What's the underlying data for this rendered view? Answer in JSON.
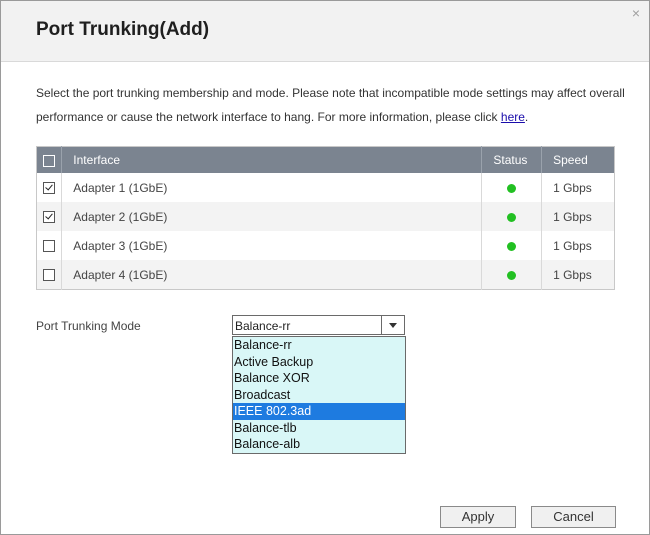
{
  "dialog": {
    "title": "Port Trunking(Add)",
    "close_glyph": "×",
    "description_text": "Select the port trunking membership and mode. Please note that incompatible mode settings may affect overall performance or cause the network interface to hang. For more information, please click ",
    "description_link": "here",
    "description_end": "."
  },
  "table": {
    "headers": {
      "interface": "Interface",
      "status": "Status",
      "speed": "Speed"
    },
    "rows": [
      {
        "interface": "Adapter 1 (1GbE)",
        "checked": true,
        "status_color": "#22c022",
        "speed": "1 Gbps"
      },
      {
        "interface": "Adapter 2 (1GbE)",
        "checked": true,
        "status_color": "#22c022",
        "speed": "1 Gbps"
      },
      {
        "interface": "Adapter 3 (1GbE)",
        "checked": false,
        "status_color": "#22c022",
        "speed": "1 Gbps"
      },
      {
        "interface": "Adapter 4 (1GbE)",
        "checked": false,
        "status_color": "#22c022",
        "speed": "1 Gbps"
      }
    ]
  },
  "mode": {
    "label": "Port Trunking Mode",
    "selected": "Balance-rr",
    "options": [
      "Balance-rr",
      "Active Backup",
      "Balance XOR",
      "Broadcast",
      "IEEE 802.3ad",
      "Balance-tlb",
      "Balance-alb"
    ],
    "highlighted": "IEEE 802.3ad"
  },
  "buttons": {
    "apply": "Apply",
    "cancel": "Cancel"
  }
}
